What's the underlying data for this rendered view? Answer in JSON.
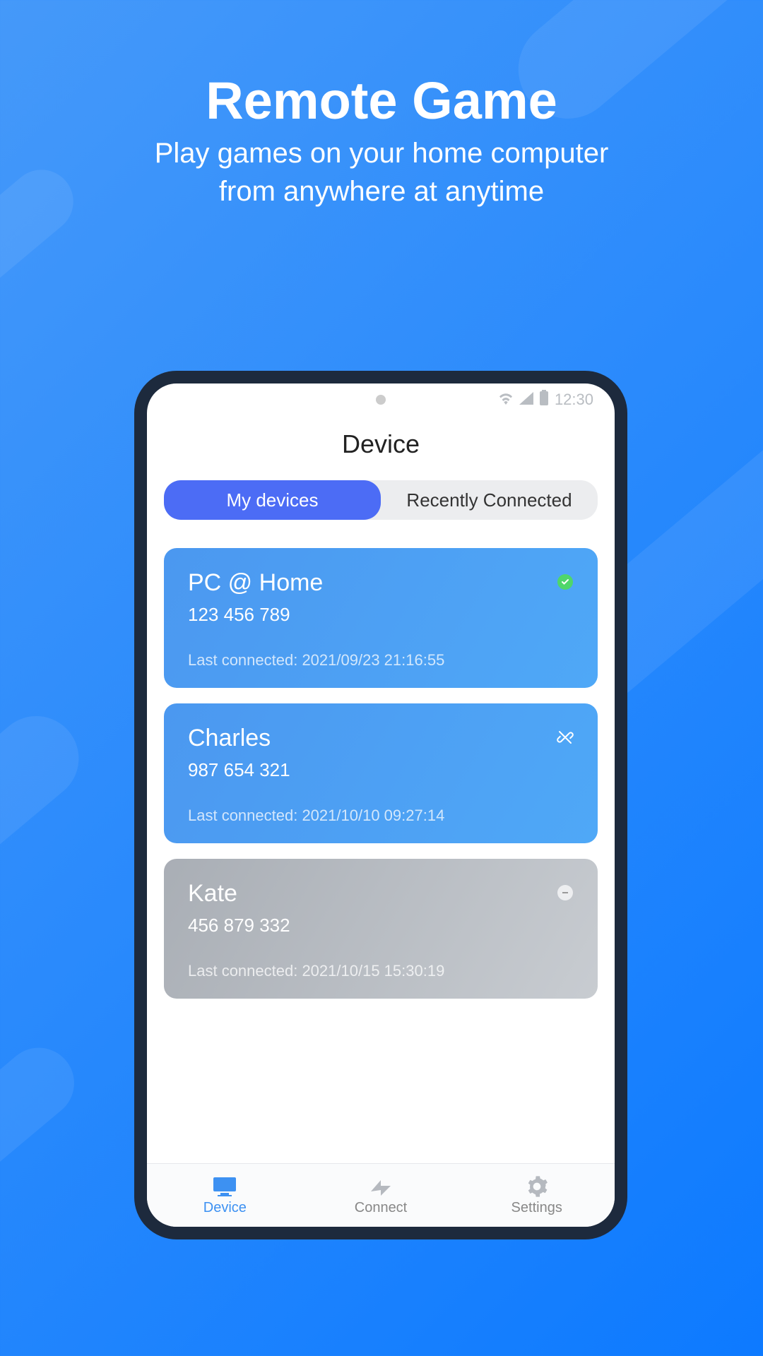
{
  "hero": {
    "title": "Remote Game",
    "subtitle_line1": "Play games on your home computer",
    "subtitle_line2": "from anywhere at anytime"
  },
  "status_bar": {
    "time": "12:30"
  },
  "page": {
    "title": "Device"
  },
  "segmented": {
    "tabs": [
      {
        "label": "My devices",
        "active": true
      },
      {
        "label": "Recently Connected",
        "active": false
      }
    ]
  },
  "devices": [
    {
      "name": "PC @ Home",
      "id": "123 456 789",
      "last": "Last connected: 2021/09/23  21:16:55",
      "status": "online-check"
    },
    {
      "name": "Charles",
      "id": "987 654 321",
      "last": "Last connected: 2021/10/10  09:27:14",
      "status": "link-broken"
    },
    {
      "name": "Kate",
      "id": "456 879 332",
      "last": "Last connected: 2021/10/15  15:30:19",
      "status": "offline"
    }
  ],
  "nav": {
    "items": [
      {
        "label": "Device",
        "active": true
      },
      {
        "label": "Connect",
        "active": false
      },
      {
        "label": "Settings",
        "active": false
      }
    ]
  }
}
